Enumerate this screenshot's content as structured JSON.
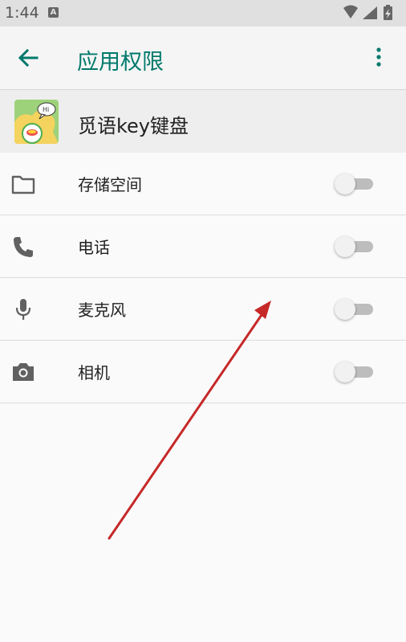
{
  "status_bar": {
    "time": "1:44",
    "notification_glyph": "A",
    "icons": [
      "wifi-icon",
      "signal-icon",
      "battery-charging-icon"
    ]
  },
  "app_bar": {
    "title": "应用权限",
    "back_icon": "arrow-back-icon",
    "more_icon": "more-vert-icon"
  },
  "app_header": {
    "name": "觅语key键盘",
    "icon_badge_text": "Hi"
  },
  "permissions": [
    {
      "label": "存储空间",
      "icon": "folder-icon",
      "enabled": false
    },
    {
      "label": "电话",
      "icon": "phone-icon",
      "enabled": false
    },
    {
      "label": "麦克风",
      "icon": "mic-icon",
      "enabled": false
    },
    {
      "label": "相机",
      "icon": "camera-icon",
      "enabled": false
    }
  ],
  "colors": {
    "accent": "#00796b",
    "annotation_arrow": "#c62828"
  }
}
